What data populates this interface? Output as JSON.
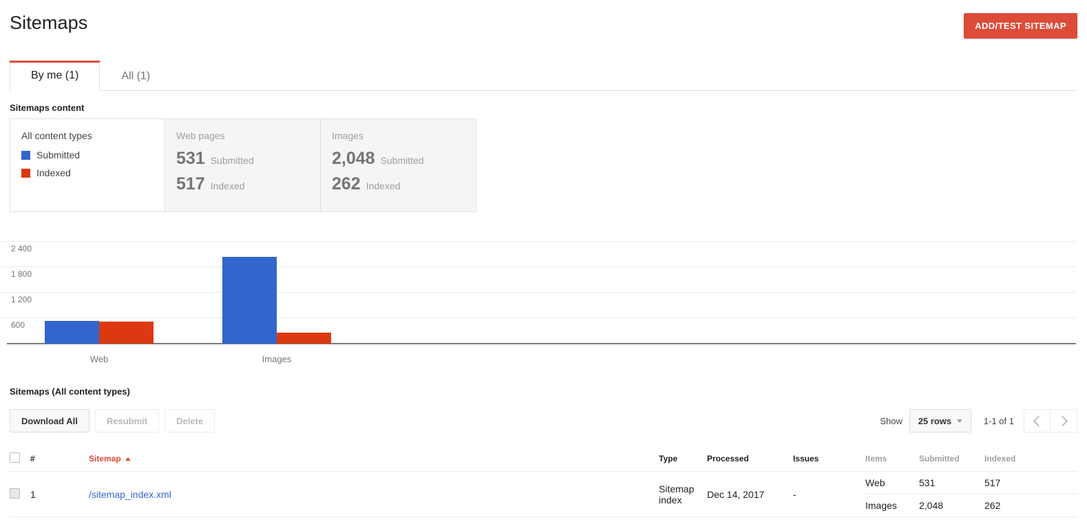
{
  "header": {
    "title": "Sitemaps",
    "add_test_button": "ADD/TEST SITEMAP"
  },
  "tabs": [
    {
      "label": "By me (1)",
      "active": true
    },
    {
      "label": "All (1)",
      "active": false
    }
  ],
  "content_section": {
    "heading": "Sitemaps content",
    "legend": {
      "title": "All content types",
      "items": [
        {
          "label": "Submitted",
          "color": "#3366cc"
        },
        {
          "label": "Indexed",
          "color": "#dc3912"
        }
      ]
    },
    "stat_cards": [
      {
        "title": "Web pages",
        "lines": [
          {
            "value": "531",
            "label": "Submitted"
          },
          {
            "value": "517",
            "label": "Indexed"
          }
        ]
      },
      {
        "title": "Images",
        "lines": [
          {
            "value": "2,048",
            "label": "Submitted"
          },
          {
            "value": "262",
            "label": "Indexed"
          }
        ]
      }
    ]
  },
  "chart_data": {
    "type": "bar",
    "title": "",
    "xlabel": "",
    "ylabel": "",
    "categories": [
      "Web",
      "Images"
    ],
    "series": [
      {
        "name": "Submitted",
        "color": "#3366cc",
        "values": [
          531,
          2048
        ]
      },
      {
        "name": "Indexed",
        "color": "#dc3912",
        "values": [
          517,
          262
        ]
      }
    ],
    "ylim": [
      0,
      2700
    ],
    "yticks": [
      600,
      1200,
      1800,
      2400
    ],
    "ytick_labels": [
      "600",
      "1 200",
      "1 800",
      "2 400"
    ],
    "grid": true,
    "legend_position": "left-card"
  },
  "table_section": {
    "heading": "Sitemaps (All content types)",
    "toolbar": [
      {
        "label": "Download All",
        "disabled": false
      },
      {
        "label": "Resubmit",
        "disabled": true
      },
      {
        "label": "Delete",
        "disabled": true
      }
    ],
    "pagination": {
      "show_label": "Show",
      "rows_value": "25 rows",
      "range": "1-1 of 1",
      "prev_icon": "chevron-left-icon",
      "next_icon": "chevron-right-icon"
    },
    "columns": {
      "index": "#",
      "sitemap": "Sitemap",
      "type": "Type",
      "processed": "Processed",
      "issues": "Issues",
      "items": "Items",
      "submitted": "Submitted",
      "indexed": "Indexed"
    },
    "rows": [
      {
        "index": "1",
        "sitemap": "/sitemap_index.xml",
        "type": "Sitemap index",
        "processed": "Dec 14, 2017",
        "issues": "-",
        "details": [
          {
            "items": "Web",
            "submitted": "531",
            "indexed": "517"
          },
          {
            "items": "Images",
            "submitted": "2,048",
            "indexed": "262"
          }
        ]
      }
    ]
  }
}
